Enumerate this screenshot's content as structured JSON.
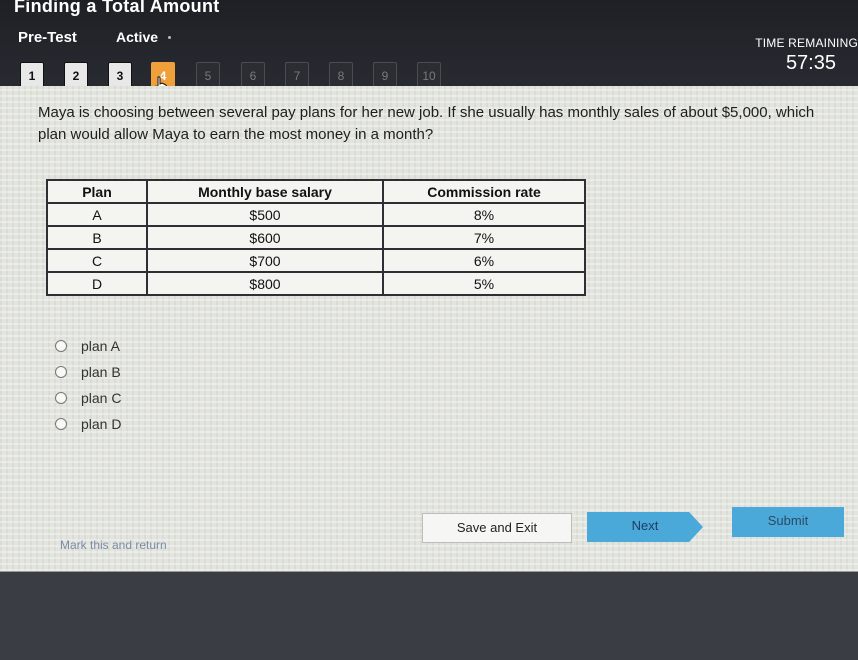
{
  "header": {
    "assignment_title": "Finding a Total Amount",
    "test_type": "Pre-Test",
    "status": "Active",
    "timer_label": "TIME REMAINING",
    "timer_value": "57:35"
  },
  "question_nav": {
    "items": [
      "1",
      "2",
      "3",
      "4",
      "5",
      "6",
      "7",
      "8",
      "9",
      "10"
    ],
    "current": "4",
    "answered": [
      "1",
      "2",
      "3"
    ]
  },
  "question": {
    "text": "Maya is choosing between several pay plans for her new job. If she usually has monthly sales of about $5,000, which plan would allow Maya to earn the most money in a month?"
  },
  "table": {
    "headers": [
      "Plan",
      "Monthly base salary",
      "Commission rate"
    ],
    "rows": [
      [
        "A",
        "$500",
        "8%"
      ],
      [
        "B",
        "$600",
        "7%"
      ],
      [
        "C",
        "$700",
        "6%"
      ],
      [
        "D",
        "$800",
        "5%"
      ]
    ]
  },
  "options": [
    "plan A",
    "plan B",
    "plan C",
    "plan D"
  ],
  "footer": {
    "mark_label": "Mark this and return",
    "save_label": "Save and Exit",
    "next_label": "Next",
    "submit_label": "Submit"
  },
  "colors": {
    "accent": "#4aa9d8",
    "current_question": "#f0a03a",
    "header_bg": "#1e2026"
  },
  "icons": {
    "cursor": "hand-pointer-icon"
  }
}
